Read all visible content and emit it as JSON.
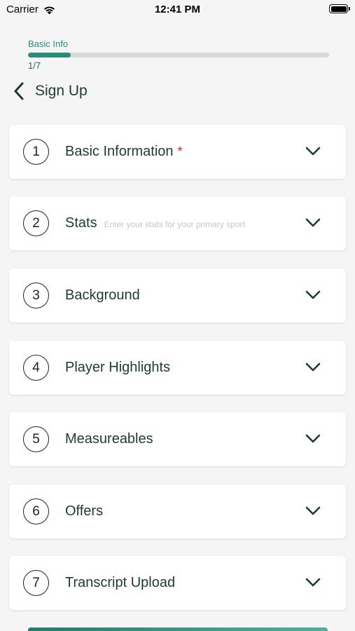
{
  "status_bar": {
    "carrier": "Carrier",
    "time": "12:41 PM"
  },
  "progress": {
    "label": "Basic Info",
    "count": "1/7",
    "fraction": 0.143
  },
  "header": {
    "title": "Sign Up"
  },
  "sections": [
    {
      "number": "1",
      "title": "Basic Information",
      "required": "*",
      "hint": ""
    },
    {
      "number": "2",
      "title": "Stats",
      "required": "",
      "hint": "Enter your stats for your primary sport"
    },
    {
      "number": "3",
      "title": "Background",
      "required": "",
      "hint": ""
    },
    {
      "number": "4",
      "title": "Player Highlights",
      "required": "",
      "hint": ""
    },
    {
      "number": "5",
      "title": "Measureables",
      "required": "",
      "hint": ""
    },
    {
      "number": "6",
      "title": "Offers",
      "required": "",
      "hint": ""
    },
    {
      "number": "7",
      "title": "Transcript Upload",
      "required": "",
      "hint": ""
    }
  ],
  "icons": {
    "back": "chevron-left-icon",
    "expand": "chevron-down-icon",
    "wifi": "wifi-icon",
    "battery": "battery-icon"
  },
  "colors": {
    "accent": "#2a8c7a",
    "text": "#1d3b33",
    "required": "#e02020"
  }
}
